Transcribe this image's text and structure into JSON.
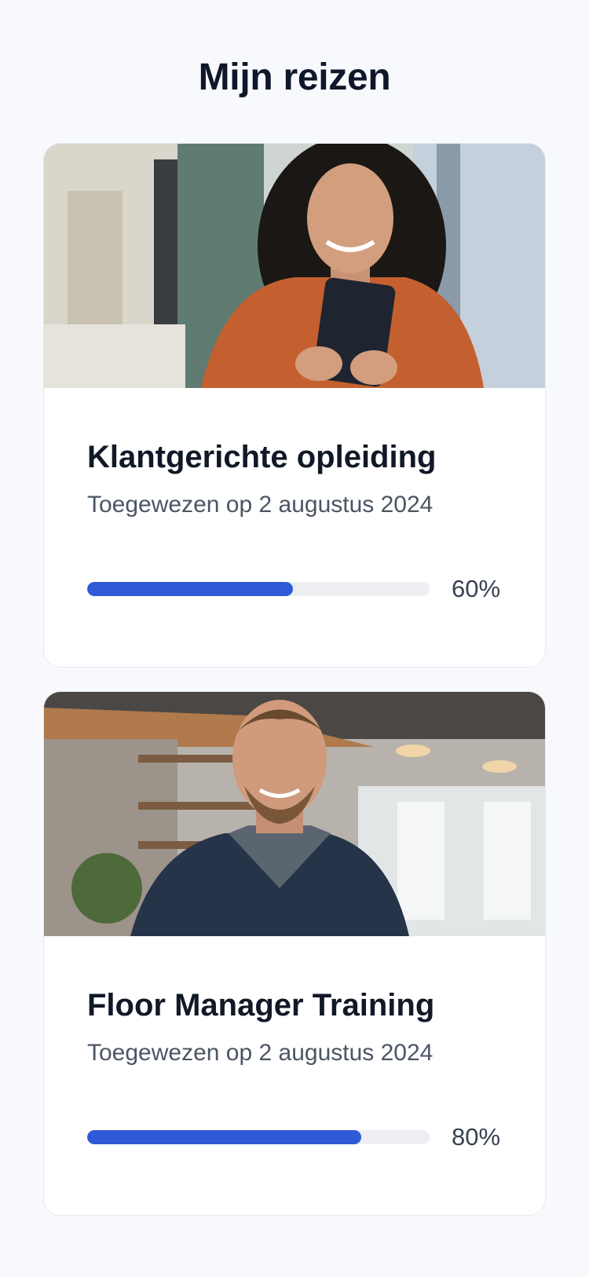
{
  "header": {
    "title": "Mijn reizen"
  },
  "cards": [
    {
      "title": "Klantgerichte opleiding",
      "assigned": "Toegewezen op 2 augustus 2024",
      "progress": 0.6,
      "progress_label": "60%",
      "photo": "woman-with-phone"
    },
    {
      "title": "Floor Manager Training",
      "assigned": "Toegewezen op 2 augustus 2024",
      "progress": 0.8,
      "progress_label": "80%",
      "photo": "smiling-man"
    }
  ],
  "colors": {
    "accent": "#2f5ad6",
    "track": "#eceef2",
    "background": "#f7f9fc"
  }
}
